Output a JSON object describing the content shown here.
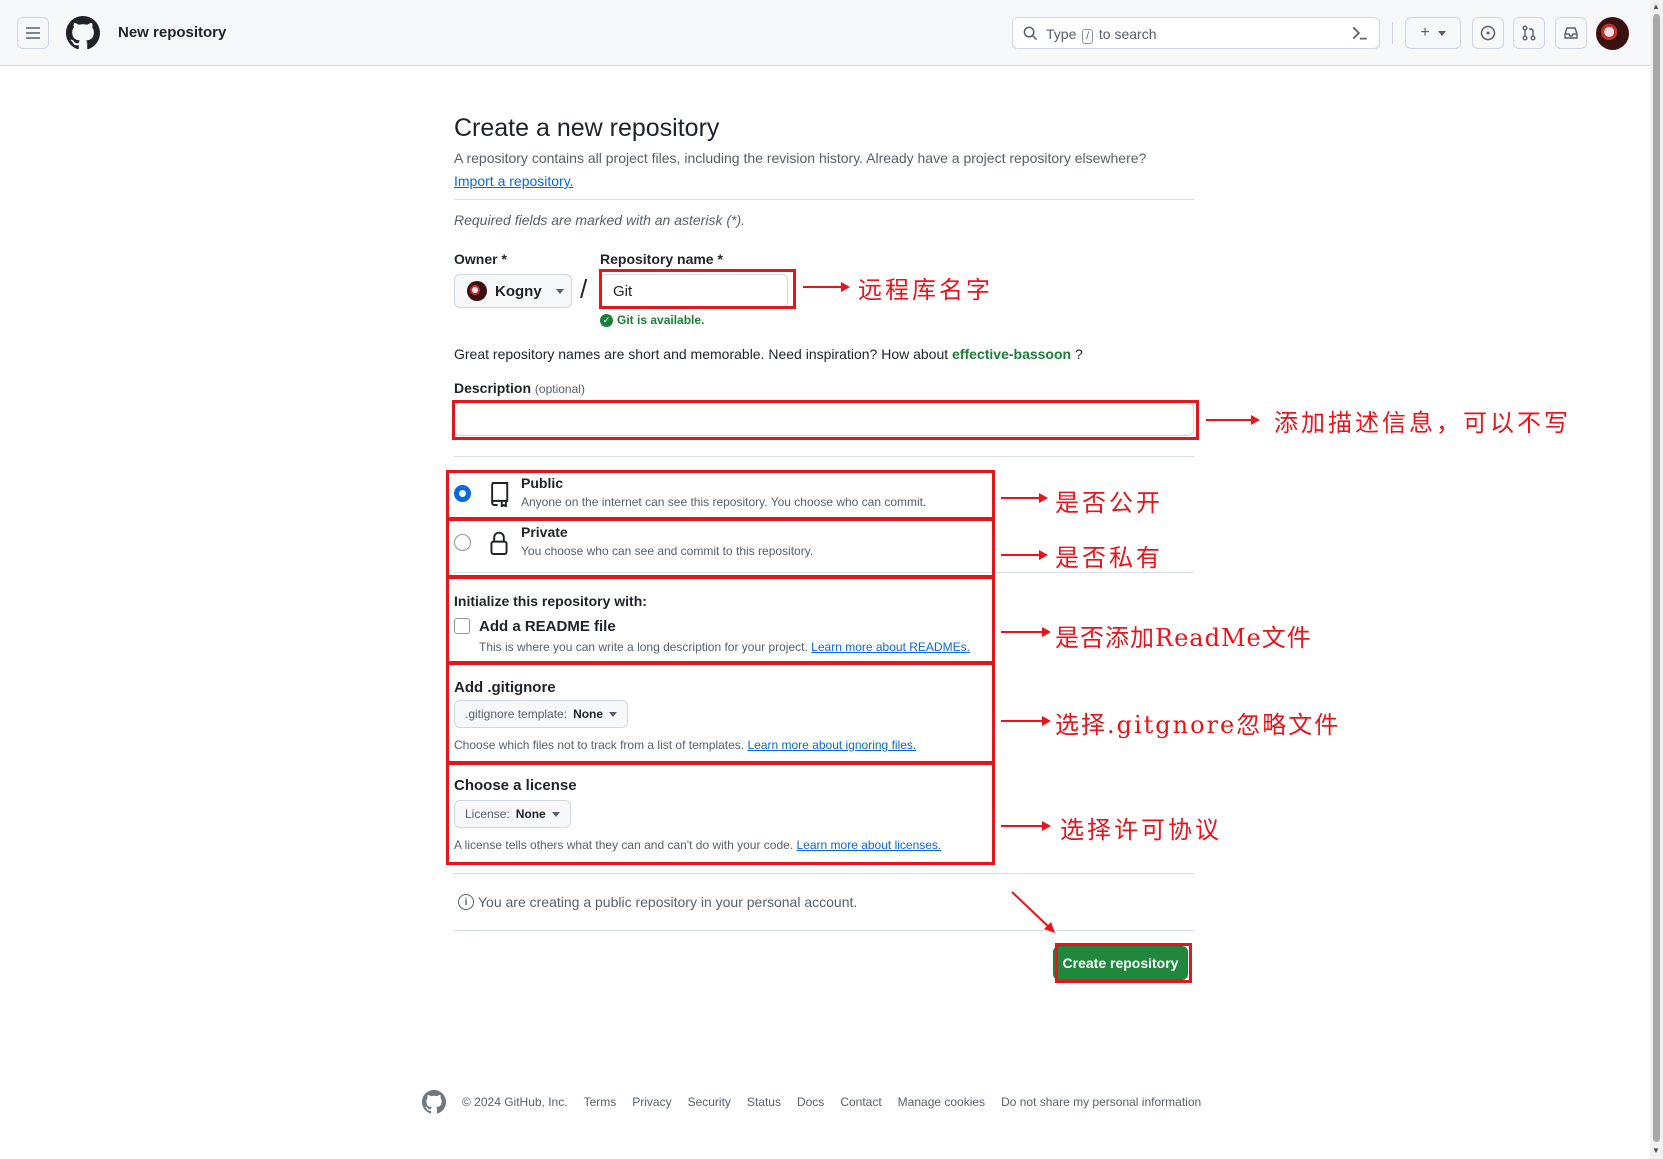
{
  "header": {
    "context_title": "New repository",
    "search_prefix": "Type",
    "search_key": "/",
    "search_suffix": "to search"
  },
  "page": {
    "title": "Create a new repository",
    "subtitle": "A repository contains all project files, including the revision history. Already have a project repository elsewhere?",
    "import_link": "Import a repository.",
    "required_note": "Required fields are marked with an asterisk (*)."
  },
  "form": {
    "owner_label": "Owner *",
    "owner_value": "Kogny",
    "repo_name_label": "Repository name *",
    "repo_name_value": "Git",
    "availability": "Git is available.",
    "inspiration_text": "Great repository names are short and memorable. Need inspiration? How about",
    "inspiration_suggestion": "effective-bassoon",
    "inspiration_end": "?",
    "description_label": "Description",
    "description_optional": "(optional)",
    "visibility": [
      {
        "title": "Public",
        "desc": "Anyone on the internet can see this repository. You choose who can commit.",
        "selected": true
      },
      {
        "title": "Private",
        "desc": "You choose who can see and commit to this repository.",
        "selected": false
      }
    ],
    "init_title": "Initialize this repository with:",
    "readme_label": "Add a README file",
    "readme_desc": "This is where you can write a long description for your project.",
    "readme_link": "Learn more about READMEs.",
    "gitignore_title": "Add .gitignore",
    "gitignore_select_prefix": ".gitignore template:",
    "gitignore_select_value": "None",
    "gitignore_desc": "Choose which files not to track from a list of templates.",
    "gitignore_link": "Learn more about ignoring files.",
    "license_title": "Choose a license",
    "license_select_prefix": "License:",
    "license_select_value": "None",
    "license_desc": "A license tells others what they can and can't do with your code.",
    "license_link": "Learn more about licenses.",
    "info_text": "You are creating a public repository in your personal account.",
    "create_button": "Create repository"
  },
  "annotations": {
    "repo_name": "远程库名字",
    "description": "添加描述信息，可以不写",
    "public": "是否公开",
    "private": "是否私有",
    "readme": "是否添加ReadMe文件",
    "gitignore": "选择.gitgnore忽略文件",
    "license": "选择许可协议",
    "color": "#e8141c"
  },
  "footer": {
    "copyright": "© 2024 GitHub, Inc.",
    "links": [
      "Terms",
      "Privacy",
      "Security",
      "Status",
      "Docs",
      "Contact",
      "Manage cookies",
      "Do not share my personal information"
    ]
  },
  "colors": {
    "primary_button": "#1f883d",
    "link": "#0969da",
    "success": "#1a7f37",
    "annotation": "#e8141c"
  }
}
